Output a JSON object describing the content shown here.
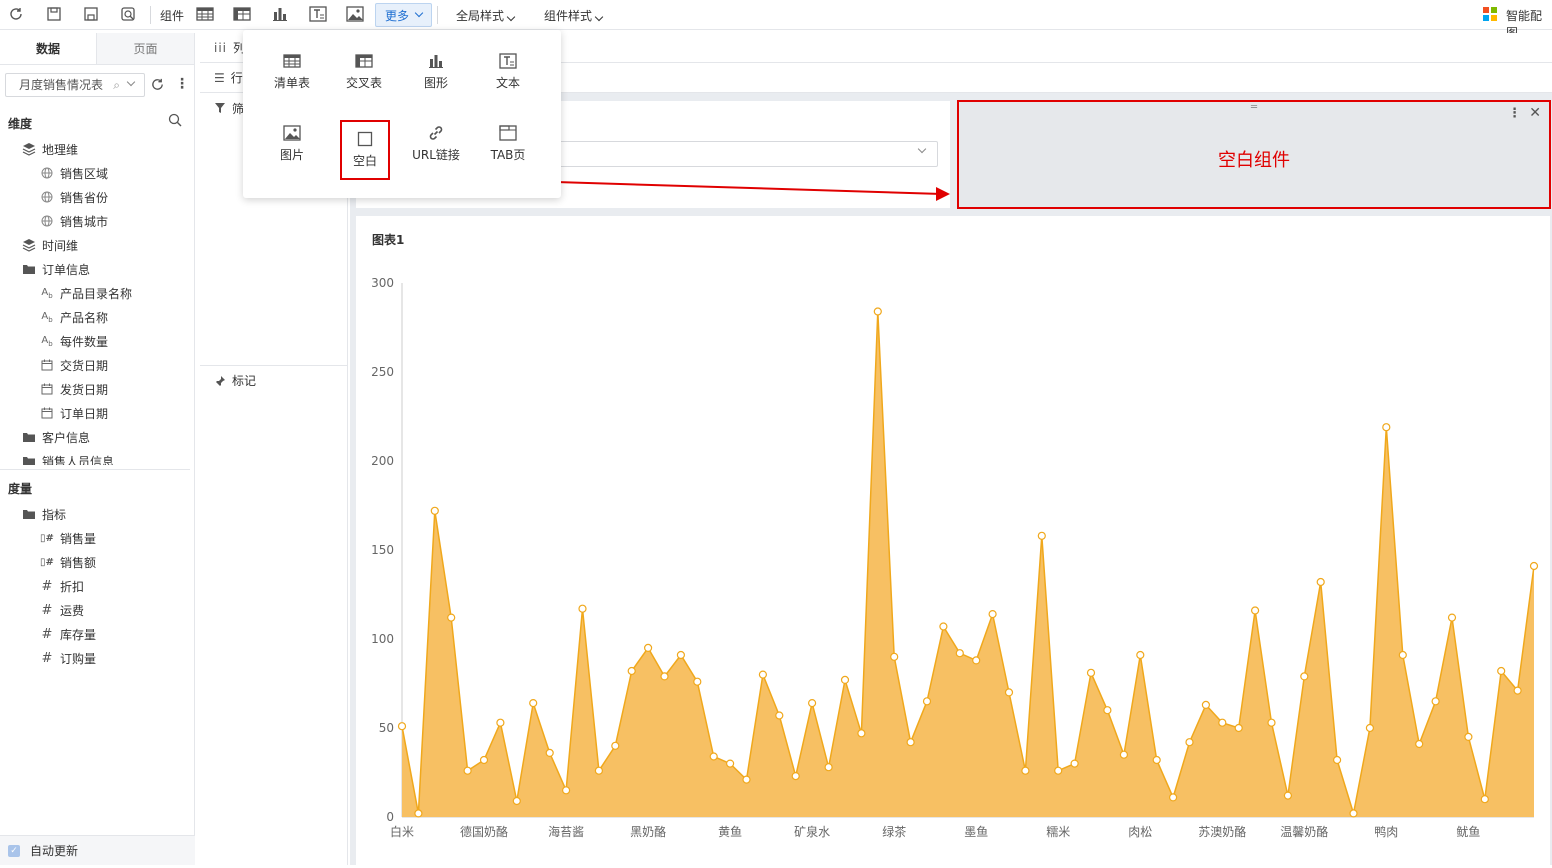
{
  "toolbar": {
    "component_label": "组件",
    "more_label": "更多",
    "global_style_label": "全局样式",
    "component_style_label": "组件样式",
    "smart_config_label": "智能配图"
  },
  "left_panel": {
    "tabs": [
      "数据",
      "页面"
    ],
    "dataset": "月度销售情况表",
    "dimension_header": "维度",
    "dimensions": [
      {
        "label": "地理维",
        "icon": "layers-icon",
        "level": 0
      },
      {
        "label": "销售区域",
        "icon": "globe-icon",
        "level": 1
      },
      {
        "label": "销售省份",
        "icon": "globe-icon",
        "level": 1
      },
      {
        "label": "销售城市",
        "icon": "globe-icon",
        "level": 1
      },
      {
        "label": "时间维",
        "icon": "layers-icon",
        "level": 0
      },
      {
        "label": "订单信息",
        "icon": "folder-icon",
        "level": 0
      },
      {
        "label": "产品目录名称",
        "icon": "text-field-icon",
        "level": 1
      },
      {
        "label": "产品名称",
        "icon": "text-field-icon",
        "level": 1
      },
      {
        "label": "每件数量",
        "icon": "text-field-icon",
        "level": 1
      },
      {
        "label": "交货日期",
        "icon": "calendar-icon",
        "level": 1
      },
      {
        "label": "发货日期",
        "icon": "calendar-icon",
        "level": 1
      },
      {
        "label": "订单日期",
        "icon": "calendar-icon",
        "level": 1
      },
      {
        "label": "客户信息",
        "icon": "folder-icon",
        "level": 0
      },
      {
        "label": "销售人员信息",
        "icon": "folder-icon",
        "level": 0
      }
    ],
    "measure_header": "度量",
    "measures": [
      {
        "label": "指标",
        "icon": "folder-icon",
        "level": 0
      },
      {
        "label": "销售量",
        "icon": "measure-icon",
        "level": 1
      },
      {
        "label": "销售额",
        "icon": "measure-icon",
        "level": 1
      },
      {
        "label": "折扣",
        "icon": "hash-icon",
        "level": 1
      },
      {
        "label": "运费",
        "icon": "hash-icon",
        "level": 1
      },
      {
        "label": "库存量",
        "icon": "hash-icon",
        "level": 1
      },
      {
        "label": "订购量",
        "icon": "hash-icon",
        "level": 1
      }
    ],
    "auto_update_label": "自动更新"
  },
  "mid_panel": {
    "columns_label": "列",
    "rows_label": "行",
    "filter_label": "筛选",
    "marks_label": "标记"
  },
  "dropdown": {
    "items": [
      {
        "label": "清单表",
        "icon": "table-icon"
      },
      {
        "label": "交叉表",
        "icon": "crosstab-icon"
      },
      {
        "label": "图形",
        "icon": "bar-chart-icon"
      },
      {
        "label": "文本",
        "icon": "text-box-icon"
      },
      {
        "label": "图片",
        "icon": "image-icon"
      },
      {
        "label": "空白",
        "icon": "blank-square-icon"
      },
      {
        "label": "URL链接",
        "icon": "link-icon"
      },
      {
        "label": "TAB页",
        "icon": "tab-page-icon"
      }
    ]
  },
  "blank_component": {
    "label": "空白组件"
  },
  "colors": {
    "accent": "#1f6fd1",
    "highlight_red": "#e00000",
    "area_fill": "#f7c063",
    "area_stroke": "#f0a81c"
  },
  "chart_data": {
    "type": "area",
    "title": "图表1",
    "ylim": [
      0,
      300
    ],
    "yticks": [
      0,
      50,
      100,
      150,
      200,
      250,
      300
    ],
    "x_tick_labels": [
      "白米",
      "德国奶酪",
      "海苔酱",
      "黑奶酪",
      "黄鱼",
      "矿泉水",
      "绿茶",
      "墨鱼",
      "糯米",
      "肉松",
      "苏澳奶酪",
      "温馨奶酪",
      "鸭肉",
      "鱿鱼"
    ],
    "values": [
      51,
      2,
      172,
      112,
      26,
      32,
      53,
      9,
      64,
      36,
      15,
      117,
      26,
      40,
      82,
      95,
      79,
      91,
      76,
      34,
      30,
      21,
      80,
      57,
      23,
      64,
      28,
      77,
      47,
      284,
      90,
      42,
      65,
      107,
      92,
      88,
      114,
      70,
      26,
      158,
      26,
      30,
      81,
      60,
      35,
      91,
      32,
      11,
      42,
      63,
      53,
      50,
      116,
      53,
      12,
      79,
      132,
      32,
      2,
      50,
      219,
      91,
      41,
      65,
      112,
      45,
      10,
      82,
      71,
      141
    ]
  }
}
